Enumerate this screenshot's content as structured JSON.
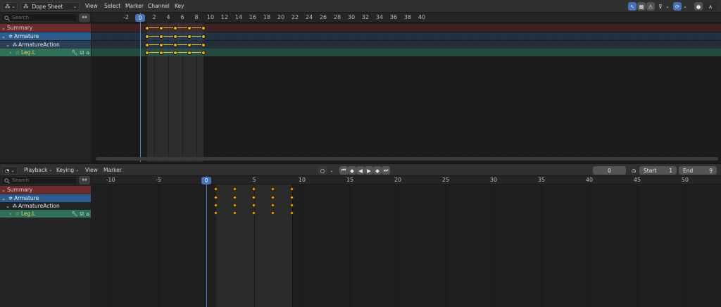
{
  "top_editor": {
    "editor_type": "Dope Sheet",
    "menus": [
      "View",
      "Select",
      "Marker",
      "Channel",
      "Key"
    ],
    "search_placeholder": "Search",
    "ruler_ticks": [
      "-2",
      "0",
      "2",
      "4",
      "6",
      "8",
      "10",
      "12",
      "14",
      "16",
      "18",
      "20",
      "22",
      "24",
      "26",
      "28",
      "30",
      "32",
      "34",
      "36",
      "38",
      "40"
    ],
    "current_frame": "0"
  },
  "bottom_editor": {
    "menus": [
      "Playback",
      "Keying",
      "View",
      "Marker"
    ],
    "search_placeholder": "Search",
    "current_frame_field": "0",
    "start_label": "Start",
    "start_value": "1",
    "end_label": "End",
    "end_value": "9",
    "ruler_ticks": [
      "-10",
      "-5",
      "0",
      "5",
      "10",
      "15",
      "20",
      "25",
      "30",
      "35",
      "40",
      "45",
      "50"
    ],
    "current_frame": "0"
  },
  "channels": [
    {
      "label": "Summary",
      "kind": "summary"
    },
    {
      "label": "Armature",
      "kind": "object"
    },
    {
      "label": "ArmatureAction",
      "kind": "action"
    },
    {
      "label": "Leg.L",
      "kind": "group"
    }
  ],
  "keyframes_frames": [
    1,
    3,
    5,
    7,
    9
  ],
  "colors": {
    "summary": "#6b2b2f",
    "object": "#2c5d8e",
    "action": "#2b3f55",
    "group": "#2f7059",
    "keyframe": "#e9b417",
    "playhead": "#4772b3"
  }
}
